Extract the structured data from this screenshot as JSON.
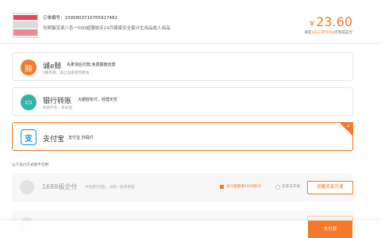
{
  "order": {
    "number_line": "订单编号：1595803710765917482",
    "title_line": "光明猫享承八色一000超薄旅牙24月健康安全套计生用品成人用品",
    "amount_currency": "¥",
    "amount_value": "23.60",
    "deadline_prefix": "请在",
    "deadline_time": "9天23时59分",
    "deadline_suffix": "内完成支付"
  },
  "methods": [
    {
      "icon": "chengyi-icon",
      "icon_glyph": "赊",
      "name": "诚e赊",
      "desc": "先拿货后付款,免费额度还款",
      "sub": "0服务费，再让卖家更周转快"
    },
    {
      "icon": "bank-card-icon",
      "icon_glyph": "▭",
      "name": "银行转账",
      "desc": "大额轻松付，经营无忧",
      "sub": "收款户名：翠米酒"
    },
    {
      "icon": "alipay-icon",
      "icon_glyph": "支",
      "name": "支付宝",
      "desc": "支付宝 扫码付",
      "selected": true
    }
  ],
  "unavailable": {
    "label": "以下支付方式暂不可用",
    "items": [
      {
        "icon": "1688-pay-icon",
        "name": "1688极企付",
        "desc": "手续费0元起，灵助一账零烦恼",
        "notice": "支付金额满1000起付",
        "radio_label": "卖家未开通",
        "button": "提醒卖家开通"
      }
    ]
  },
  "footer": {
    "pay_button": "去付款"
  },
  "colors": {
    "accent": "#f4792b",
    "bank": "#33b5a6",
    "alipay": "#1296db"
  }
}
